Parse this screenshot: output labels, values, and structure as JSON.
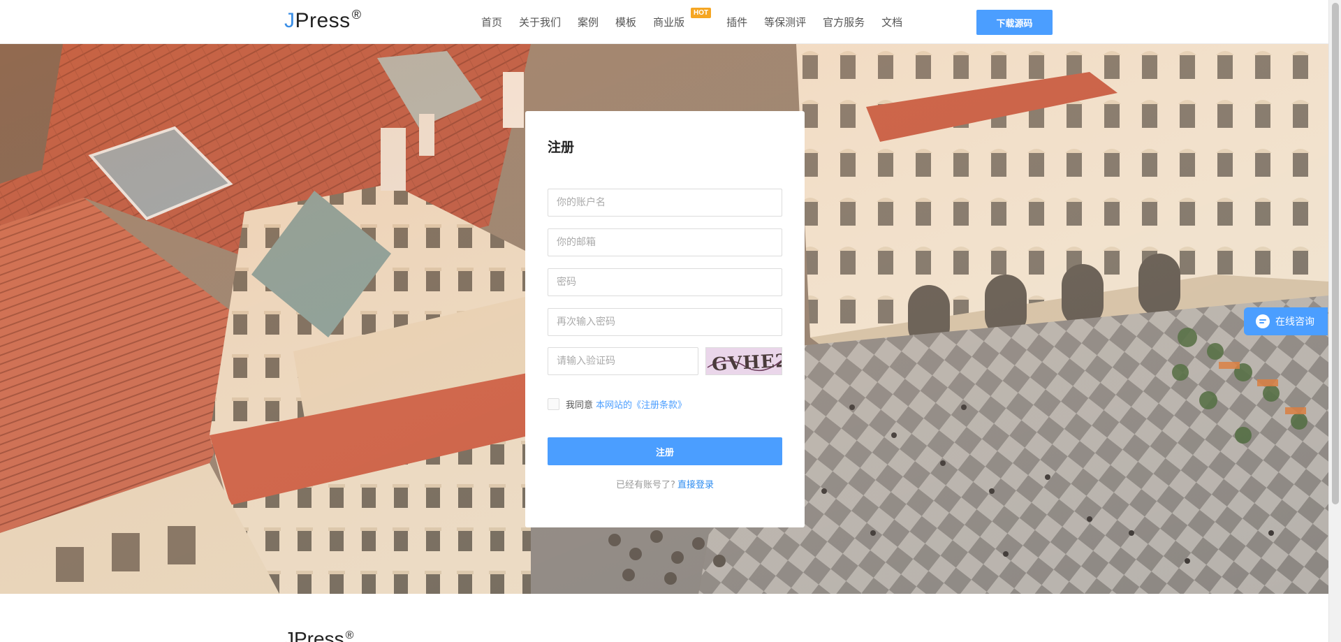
{
  "header": {
    "logo_j": "J",
    "logo_rest": "Press",
    "logo_mark": "®",
    "nav": [
      {
        "label": "首页"
      },
      {
        "label": "关于我们"
      },
      {
        "label": "案例"
      },
      {
        "label": "模板"
      },
      {
        "label": "商业版",
        "badge": "HOT"
      },
      {
        "label": "插件"
      },
      {
        "label": "等保测评"
      },
      {
        "label": "官方服务"
      },
      {
        "label": "文档"
      }
    ],
    "download_label": "下载源码"
  },
  "register": {
    "title": "注册",
    "username_placeholder": "你的账户名",
    "email_placeholder": "你的邮箱",
    "password_placeholder": "密码",
    "confirm_placeholder": "再次输入密码",
    "captcha_placeholder": "请输入验证码",
    "captcha_text": "GVHE2",
    "agree_prefix": "我同意",
    "agree_terms": "本网站的《注册条款》",
    "submit_label": "注册",
    "login_prompt": "已经有账号了?",
    "login_link": "直接登录"
  },
  "consult": {
    "label": "在线咨询",
    "icon": "chat-bubble-icon"
  },
  "footer": {
    "logo_text": "JPress",
    "logo_mark": "®"
  },
  "colors": {
    "primary": "#4b9eff",
    "hot_badge": "#f5a623",
    "link": "#2d8cf0"
  }
}
